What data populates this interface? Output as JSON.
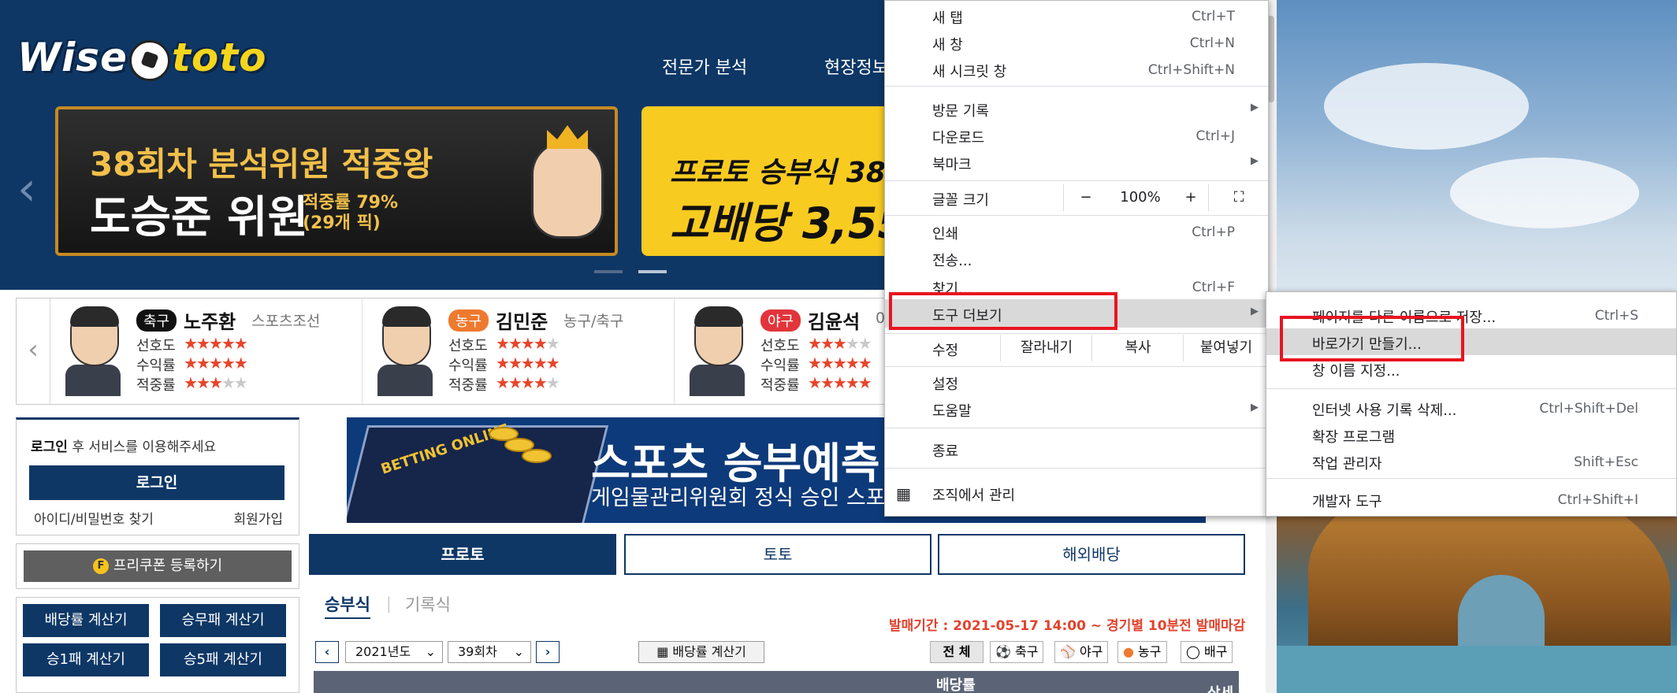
{
  "site": {
    "logo_left": "Wise",
    "logo_right": "toto",
    "nav": [
      "전문가 분석",
      "현장정보"
    ],
    "banner1": {
      "line1": "38회차 분석위원 적중왕",
      "line2": "도승준 위원",
      "line3": "적중률 79% (29개 픽)"
    },
    "banner2": {
      "line1": "프로토 승부식 38",
      "line2": "고배당 3,55"
    },
    "experts": [
      {
        "tag": "축구",
        "tag_color": "#111111",
        "name": "노주환",
        "affiliation": "스포츠조선",
        "stats": [
          {
            "label": "선호도",
            "stars": 5
          },
          {
            "label": "수익률",
            "stars": 4.5
          },
          {
            "label": "적중률",
            "stars": 2.5
          }
        ]
      },
      {
        "tag": "농구",
        "tag_color": "#ee7a2f",
        "name": "김민준",
        "affiliation": "농구/축구",
        "stats": [
          {
            "label": "선호도",
            "stars": 3.5
          },
          {
            "label": "수익률",
            "stars": 5
          },
          {
            "label": "적중률",
            "stars": 3.5
          }
        ]
      },
      {
        "tag": "야구",
        "tag_color": "#e2353b",
        "name": "김윤석",
        "affiliation": "0",
        "stats": [
          {
            "label": "선호도",
            "stars": 2.5
          },
          {
            "label": "수익률",
            "stars": 5
          },
          {
            "label": "적중률",
            "stars": 5
          }
        ]
      }
    ],
    "login": {
      "bold": "로그인",
      "text": " 후 서비스를 이용해주세요",
      "button": "로그인",
      "find": "아이디/비밀번호 찾기",
      "join": "회원가입"
    },
    "coupon": {
      "icon": "F",
      "label": "프리쿠폰 등록하기"
    },
    "calculators": [
      "배당률 계산기",
      "승무패 계산기",
      "승1패 계산기",
      "승5패 계산기"
    ],
    "ad": {
      "badge": "BETTING ONLINE",
      "title": "스포츠 승부예측",
      "subtitle": "게임물관리위원회 정식 승인 스포츠"
    },
    "tabs": [
      "프로토",
      "토토",
      "해외배당"
    ],
    "subtabs": [
      "승부식",
      "기록식"
    ],
    "sale_period": "발매기간 : 2021-05-17 14:00 ~ 경기별 10분전 발매마감",
    "year_select": "2021년도",
    "round_select": "39회차",
    "calc_button": "배당률 계산기",
    "sports": [
      "전 체",
      "축구",
      "야구",
      "농구",
      "배구"
    ],
    "table_header": {
      "odds": "배당률",
      "detail": "상세"
    }
  },
  "menu": {
    "items": [
      {
        "label": "새 탭",
        "shortcut": "Ctrl+T"
      },
      {
        "label": "새 창",
        "shortcut": "Ctrl+N"
      },
      {
        "label": "새 시크릿 창",
        "shortcut": "Ctrl+Shift+N"
      },
      {
        "label": "방문 기록",
        "shortcut": ""
      },
      {
        "label": "다운로드",
        "shortcut": "Ctrl+J"
      },
      {
        "label": "북마크",
        "shortcut": ""
      },
      {
        "label": "인쇄",
        "shortcut": "Ctrl+P"
      },
      {
        "label": "전송...",
        "shortcut": ""
      },
      {
        "label": "찾기...",
        "shortcut": "Ctrl+F"
      },
      {
        "label": "도구 더보기",
        "shortcut": ""
      },
      {
        "label": "설정",
        "shortcut": ""
      },
      {
        "label": "도움말",
        "shortcut": ""
      },
      {
        "label": "종료",
        "shortcut": ""
      },
      {
        "label": "조직에서 관리",
        "shortcut": ""
      }
    ],
    "zoom": {
      "label": "글꼴 크기",
      "minus": "−",
      "value": "100%",
      "plus": "+",
      "fullscreen": "⛶"
    },
    "edit": {
      "label": "수정",
      "cut": "잘라내기",
      "copy": "복사",
      "paste": "붙여넣기"
    }
  },
  "submenu": {
    "items": [
      {
        "label": "페이지를 다른 이름으로 저장...",
        "shortcut": "Ctrl+S"
      },
      {
        "label": "바로가기 만들기...",
        "shortcut": ""
      },
      {
        "label": "창 이름 지정...",
        "shortcut": ""
      },
      {
        "label": "인터넷 사용 기록 삭제...",
        "shortcut": "Ctrl+Shift+Del"
      },
      {
        "label": "확장 프로그램",
        "shortcut": ""
      },
      {
        "label": "작업 관리자",
        "shortcut": "Shift+Esc"
      },
      {
        "label": "개발자 도구",
        "shortcut": "Ctrl+Shift+I"
      }
    ]
  },
  "colors": {
    "brand": "#0e3766",
    "highlight_box": "#e8141f",
    "accent_red": "#e2432d"
  }
}
